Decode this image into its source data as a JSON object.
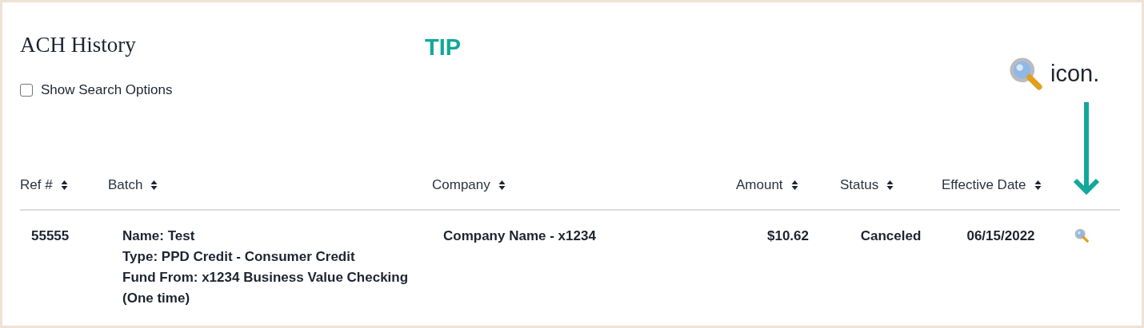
{
  "title": "ACH History",
  "search_options": {
    "label": "Show Search Options",
    "checked": false
  },
  "annotations": {
    "tip": "TIP",
    "callout": "icon."
  },
  "table": {
    "columns": [
      "Ref #",
      "Batch",
      "Company",
      "Amount",
      "Status",
      "Effective Date"
    ],
    "rows": [
      {
        "ref": "55555",
        "batch": [
          "Name: Test",
          "Type: PPD Credit - Consumer Credit",
          "Fund From: x1234 Business Value Checking",
          "(One time)"
        ],
        "company": "Company Name - x1234",
        "amount": "$10.62",
        "status": "Canceled",
        "effective_date": "06/15/2022"
      }
    ]
  }
}
